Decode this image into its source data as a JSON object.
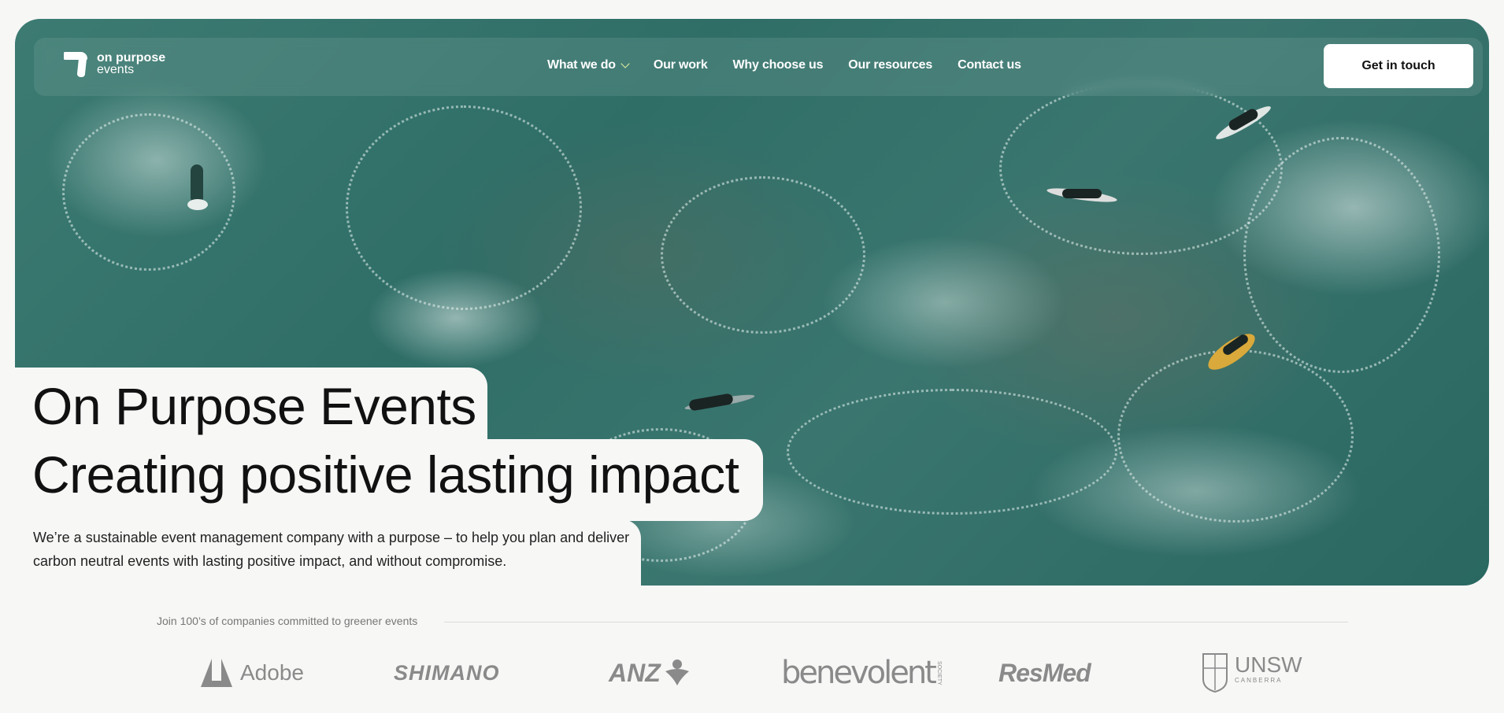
{
  "nav": {
    "logo_line1": "on purpose",
    "logo_line2": "events",
    "items": [
      {
        "label": "What we do",
        "has_dropdown": true
      },
      {
        "label": "Our work"
      },
      {
        "label": "Why choose us"
      },
      {
        "label": "Our resources"
      },
      {
        "label": "Contact us"
      }
    ],
    "cta_label": "Get in touch"
  },
  "hero": {
    "title_line1": "On Purpose Events",
    "title_line2": "Creating positive lasting impact",
    "subtitle": "We’re a sustainable event management company with a purpose – to help you plan and deliver carbon neutral events with lasting positive impact, and without compromise."
  },
  "clients": {
    "heading": "Join 100’s of companies committed to greener events",
    "logos": [
      "Adobe",
      "SHIMANO",
      "ANZ",
      "benevolent",
      "ResMed",
      "UNSW"
    ],
    "benevolent_suffix": "SOCIETY",
    "unsw_sub": "CANBERRA"
  },
  "colors": {
    "accent": "#e8f2a0",
    "page_bg": "#f7f7f6",
    "hero_water": "#2f6e67",
    "logo_gray": "#8a8a8a"
  }
}
